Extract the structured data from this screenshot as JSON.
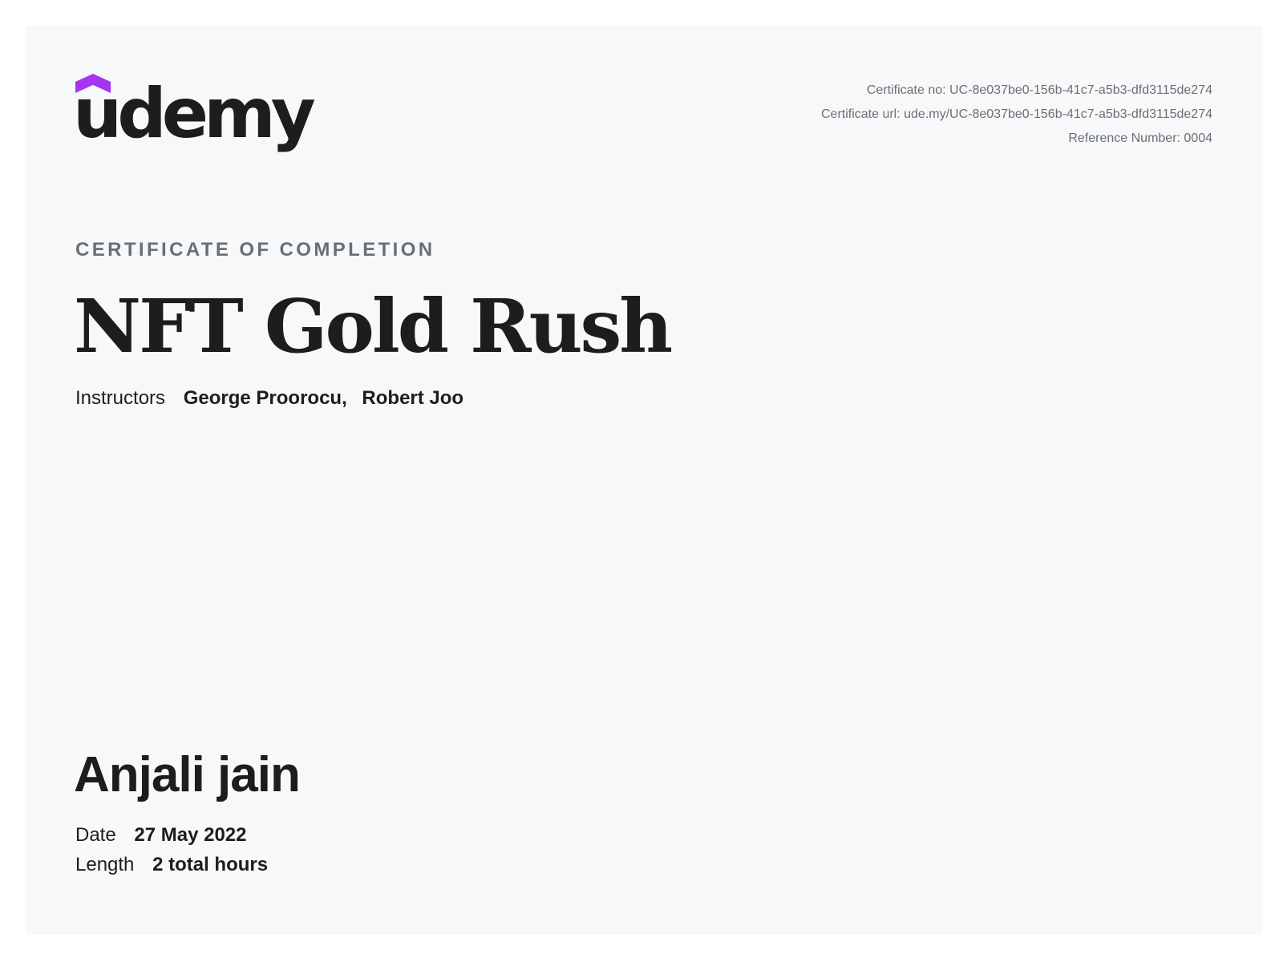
{
  "brand": {
    "logo_text": "udemy",
    "accent_color": "#a435f0",
    "text_color": "#1c1d1f"
  },
  "meta": {
    "certificate_no": "Certificate no: UC-8e037be0-156b-41c7-a5b3-dfd3115de274",
    "certificate_url": "Certificate url: ude.my/UC-8e037be0-156b-41c7-a5b3-dfd3115de274",
    "reference_number": "Reference Number: 0004"
  },
  "certificate": {
    "eyebrow": "CERTIFICATE OF COMPLETION",
    "course_title": "NFT Gold Rush",
    "instructors_label": "Instructors",
    "instructors": [
      "George Proorocu",
      "Robert Joo"
    ],
    "instructor_separator": ",",
    "recipient": "Anjali jain",
    "date_label": "Date",
    "date_value": "27 May 2022",
    "length_label": "Length",
    "length_value": "2 total hours"
  }
}
